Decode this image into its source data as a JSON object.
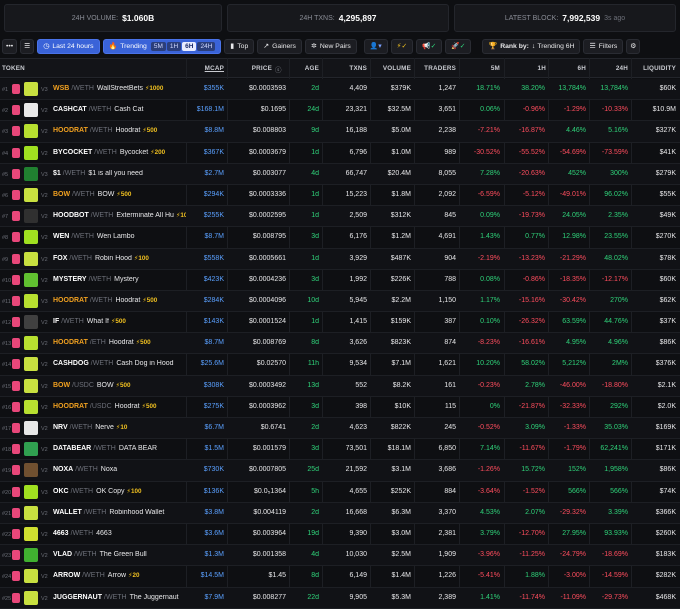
{
  "stats": {
    "volume_label": "24H VOLUME:",
    "volume_value": "$1.060B",
    "txns_label": "24H TXNS:",
    "txns_value": "4,295,897",
    "block_label": "LATEST BLOCK:",
    "block_value": "7,992,539",
    "block_ago": "3s ago"
  },
  "toolbar": {
    "period_label": "Last 24 hours",
    "trending_label": "Trending",
    "trending_options": [
      "5M",
      "1H",
      "6H",
      "24H"
    ],
    "trending_selected": "6H",
    "top_label": "Top",
    "gainers_label": "Gainers",
    "new_pairs_label": "New Pairs",
    "rank_label": "Rank by:",
    "rank_value": "Trending 6H",
    "filters_label": "Filters"
  },
  "columns": [
    "TOKEN",
    "MCAP",
    "PRICE",
    "AGE",
    "TXNS",
    "VOLUME",
    "TRADERS",
    "5M",
    "1H",
    "6H",
    "24H",
    "LIQUIDITY"
  ],
  "rows": [
    {
      "rank": "#1",
      "ver": "V3",
      "sym": "WSB",
      "orange": true,
      "pair": "/WETH",
      "name": "WallStreetBets",
      "boost": "⚡1000",
      "mcap": "$355K",
      "price": "$0.0003593",
      "age": "2d",
      "txns": "4,409",
      "volume": "$379K",
      "traders": "1,247",
      "m5": "18.71%",
      "h1": "38.20%",
      "h6": "13,784%",
      "h24": "13,784%",
      "liq": "$60K",
      "av": "#c8e040"
    },
    {
      "rank": "#2",
      "ver": "V2",
      "sym": "CASHCAT",
      "orange": false,
      "pair": "/WETH",
      "name": "Cash Cat",
      "boost": "",
      "mcap": "$168.1M",
      "price": "$0.1695",
      "age": "24d",
      "txns": "23,321",
      "volume": "$32.5M",
      "traders": "3,651",
      "m5": "0.06%",
      "h1": "-0.96%",
      "h6": "-1.29%",
      "h24": "-10.33%",
      "liq": "$10.9M",
      "av": "#e8e8e8"
    },
    {
      "rank": "#3",
      "ver": "V2",
      "sym": "HOODRAT",
      "orange": true,
      "pair": "/WETH",
      "name": "Hoodrat",
      "boost": "⚡500",
      "mcap": "$8.8M",
      "price": "$0.008803",
      "age": "9d",
      "txns": "16,188",
      "volume": "$5.0M",
      "traders": "2,238",
      "m5": "-7.21%",
      "h1": "-16.87%",
      "h6": "4.46%",
      "h24": "5.16%",
      "liq": "$327K",
      "av": "#b8e030"
    },
    {
      "rank": "#4",
      "ver": "V2",
      "sym": "BYCOCKET",
      "orange": false,
      "pair": "/WETH",
      "name": "Bycocket",
      "boost": "⚡200",
      "mcap": "$367K",
      "price": "$0.0003679",
      "age": "1d",
      "txns": "6,796",
      "volume": "$1.0M",
      "traders": "989",
      "m5": "-30.52%",
      "h1": "-55.52%",
      "h6": "-54.69%",
      "h24": "-73.59%",
      "liq": "$41K",
      "av": "#a0e020"
    },
    {
      "rank": "#5",
      "ver": "V3",
      "sym": "$1",
      "orange": false,
      "pair": "/WETH",
      "name": "$1 is all you need",
      "boost": "",
      "mcap": "$2.7M",
      "price": "$0.003077",
      "age": "4d",
      "txns": "66,747",
      "volume": "$20.4M",
      "traders": "8,055",
      "m5": "7.28%",
      "h1": "-20.63%",
      "h6": "452%",
      "h24": "300%",
      "liq": "$279K",
      "av": "#208030"
    },
    {
      "rank": "#6",
      "ver": "V2",
      "sym": "BOW",
      "orange": true,
      "pair": "/WETH",
      "name": "BOW",
      "boost": "⚡500",
      "mcap": "$294K",
      "price": "$0.0003336",
      "age": "1d",
      "txns": "15,223",
      "volume": "$1.8M",
      "traders": "2,092",
      "m5": "-6.59%",
      "h1": "-5.12%",
      "h6": "-49.01%",
      "h24": "96.02%",
      "liq": "$55K",
      "av": "#c8e040"
    },
    {
      "rank": "#7",
      "ver": "V2",
      "sym": "HOODBOT",
      "orange": false,
      "pair": "/WETH",
      "name": "Exterminate All Hu",
      "boost": "⚡10",
      "mcap": "$255K",
      "price": "$0.0002595",
      "age": "1d",
      "txns": "2,509",
      "volume": "$312K",
      "traders": "845",
      "m5": "0.09%",
      "h1": "-19.73%",
      "h6": "24.05%",
      "h24": "2.35%",
      "liq": "$49K",
      "av": "#303030"
    },
    {
      "rank": "#8",
      "ver": "V2",
      "sym": "WEN",
      "orange": false,
      "pair": "/WETH",
      "name": "Wen Lambo",
      "boost": "",
      "mcap": "$8.7M",
      "price": "$0.008795",
      "age": "3d",
      "txns": "6,176",
      "volume": "$1.2M",
      "traders": "4,691",
      "m5": "1.43%",
      "h1": "0.77%",
      "h6": "12.98%",
      "h24": "23.55%",
      "liq": "$270K",
      "av": "#a0e020"
    },
    {
      "rank": "#9",
      "ver": "V2",
      "sym": "FOX",
      "orange": false,
      "pair": "/WETH",
      "name": "Robin Hood",
      "boost": "⚡100",
      "mcap": "$558K",
      "price": "$0.0005661",
      "age": "1d",
      "txns": "3,929",
      "volume": "$487K",
      "traders": "904",
      "m5": "-2.19%",
      "h1": "-13.23%",
      "h6": "-21.29%",
      "h24": "48.02%",
      "liq": "$78K",
      "av": "#c8e040"
    },
    {
      "rank": "#10",
      "ver": "V2",
      "sym": "MYSTERY",
      "orange": false,
      "pair": "/WETH",
      "name": "Mystery",
      "boost": "",
      "mcap": "$423K",
      "price": "$0.0004236",
      "age": "3d",
      "txns": "1,992",
      "volume": "$226K",
      "traders": "788",
      "m5": "0.08%",
      "h1": "-0.86%",
      "h6": "-18.35%",
      "h24": "-12.17%",
      "liq": "$60K",
      "av": "#60c030"
    },
    {
      "rank": "#11",
      "ver": "V3",
      "sym": "HOODRAT",
      "orange": true,
      "pair": "/WETH",
      "name": "Hoodrat",
      "boost": "⚡500",
      "mcap": "$284K",
      "price": "$0.0004096",
      "age": "10d",
      "txns": "5,945",
      "volume": "$2.2M",
      "traders": "1,150",
      "m5": "1.17%",
      "h1": "-15.16%",
      "h6": "-30.42%",
      "h24": "270%",
      "liq": "$62K",
      "av": "#b8e030"
    },
    {
      "rank": "#12",
      "ver": "V2",
      "sym": "IF",
      "orange": false,
      "pair": "/WETH",
      "name": "What If",
      "boost": "⚡500",
      "mcap": "$143K",
      "price": "$0.0001524",
      "age": "1d",
      "txns": "1,415",
      "volume": "$159K",
      "traders": "387",
      "m5": "0.10%",
      "h1": "-26.32%",
      "h6": "63.59%",
      "h24": "44.76%",
      "liq": "$37K",
      "av": "#404040"
    },
    {
      "rank": "#13",
      "ver": "V2",
      "sym": "HOODRAT",
      "orange": true,
      "pair": "/ETH",
      "name": "Hoodrat",
      "boost": "⚡500",
      "mcap": "$8.7M",
      "price": "$0.008769",
      "age": "8d",
      "txns": "3,626",
      "volume": "$823K",
      "traders": "874",
      "m5": "-8.23%",
      "h1": "-16.61%",
      "h6": "4.95%",
      "h24": "4.96%",
      "liq": "$86K",
      "av": "#b8e030"
    },
    {
      "rank": "#14",
      "ver": "V2",
      "sym": "CASHDOG",
      "orange": false,
      "pair": "/WETH",
      "name": "Cash Dog in Hood",
      "boost": "",
      "mcap": "$25.6M",
      "price": "$0.02570",
      "age": "11h",
      "txns": "9,534",
      "volume": "$7.1M",
      "traders": "1,621",
      "m5": "10.20%",
      "h1": "58.02%",
      "h6": "5,212%",
      "h24": "2M%",
      "liq": "$376K",
      "av": "#c8e040"
    },
    {
      "rank": "#15",
      "ver": "V2",
      "sym": "BOW",
      "orange": true,
      "pair": "/USDC",
      "name": "BOW",
      "boost": "⚡500",
      "mcap": "$308K",
      "price": "$0.0003492",
      "age": "13d",
      "txns": "552",
      "volume": "$8.2K",
      "traders": "161",
      "m5": "-0.23%",
      "h1": "2.78%",
      "h6": "-46.00%",
      "h24": "-18.80%",
      "liq": "$2.1K",
      "av": "#c8e040"
    },
    {
      "rank": "#16",
      "ver": "V2",
      "sym": "HOODRAT",
      "orange": true,
      "pair": "/USDC",
      "name": "Hoodrat",
      "boost": "⚡500",
      "mcap": "$275K",
      "price": "$0.0003962",
      "age": "3d",
      "txns": "398",
      "volume": "$10K",
      "traders": "115",
      "m5": "0%",
      "h1": "-21.87%",
      "h6": "-32.33%",
      "h24": "292%",
      "liq": "$2.0K",
      "av": "#b8e030"
    },
    {
      "rank": "#17",
      "ver": "V2",
      "sym": "NRV",
      "orange": false,
      "pair": "/WETH",
      "name": "Nerve",
      "boost": "⚡10",
      "mcap": "$6.7M",
      "price": "$0.6741",
      "age": "2d",
      "txns": "4,623",
      "volume": "$822K",
      "traders": "245",
      "m5": "-0.52%",
      "h1": "3.09%",
      "h6": "-1.33%",
      "h24": "35.03%",
      "liq": "$169K",
      "av": "#e8e8e8"
    },
    {
      "rank": "#18",
      "ver": "V2",
      "sym": "DATABEAR",
      "orange": false,
      "pair": "/WETH",
      "name": "DATA BEAR",
      "boost": "",
      "mcap": "$1.5M",
      "price": "$0.001579",
      "age": "3d",
      "txns": "73,501",
      "volume": "$18.1M",
      "traders": "6,850",
      "m5": "7.14%",
      "h1": "-11.67%",
      "h6": "-1.79%",
      "h24": "62,241%",
      "liq": "$171K",
      "av": "#30a050"
    },
    {
      "rank": "#19",
      "ver": "V2",
      "sym": "NOXA",
      "orange": false,
      "pair": "/WETH",
      "name": "Noxa",
      "boost": "",
      "mcap": "$730K",
      "price": "$0.0007805",
      "age": "25d",
      "txns": "21,592",
      "volume": "$3.1M",
      "traders": "3,686",
      "m5": "-1.26%",
      "h1": "15.72%",
      "h6": "152%",
      "h24": "1,958%",
      "liq": "$86K",
      "av": "#705030"
    },
    {
      "rank": "#20",
      "ver": "V3",
      "sym": "OKC",
      "orange": false,
      "pair": "/WETH",
      "name": "OK Copy",
      "boost": "⚡100",
      "mcap": "$136K",
      "price": "$0.0₅1364",
      "age": "5h",
      "txns": "4,655",
      "volume": "$252K",
      "traders": "884",
      "m5": "-3.64%",
      "h1": "-1.52%",
      "h6": "566%",
      "h24": "566%",
      "liq": "$74K",
      "av": "#a0e020"
    },
    {
      "rank": "#21",
      "ver": "V2",
      "sym": "WALLET",
      "orange": false,
      "pair": "/WETH",
      "name": "Robinhood Wallet",
      "boost": "",
      "mcap": "$3.8M",
      "price": "$0.004119",
      "age": "2d",
      "txns": "16,668",
      "volume": "$6.3M",
      "traders": "3,370",
      "m5": "4.53%",
      "h1": "2.07%",
      "h6": "-29.32%",
      "h24": "3.39%",
      "liq": "$366K",
      "av": "#c8e040"
    },
    {
      "rank": "#22",
      "ver": "V2",
      "sym": "4663",
      "orange": false,
      "pair": "/WETH",
      "name": "4663",
      "boost": "",
      "mcap": "$3.6M",
      "price": "$0.003964",
      "age": "19d",
      "txns": "9,390",
      "volume": "$3.0M",
      "traders": "2,381",
      "m5": "3.79%",
      "h1": "-12.70%",
      "h6": "27.95%",
      "h24": "93.93%",
      "liq": "$260K",
      "av": "#d0e030"
    },
    {
      "rank": "#23",
      "ver": "V2",
      "sym": "VLAD",
      "orange": false,
      "pair": "/WETH",
      "name": "The Green Bull",
      "boost": "",
      "mcap": "$1.3M",
      "price": "$0.001358",
      "age": "4d",
      "txns": "10,030",
      "volume": "$2.5M",
      "traders": "1,909",
      "m5": "-3.96%",
      "h1": "-11.25%",
      "h6": "-24.79%",
      "h24": "-18.69%",
      "liq": "$183K",
      "av": "#40b030"
    },
    {
      "rank": "#24",
      "ver": "V2",
      "sym": "ARROW",
      "orange": false,
      "pair": "/WETH",
      "name": "Arrow",
      "boost": "⚡20",
      "mcap": "$14.5M",
      "price": "$1.45",
      "age": "8d",
      "txns": "6,149",
      "volume": "$1.4M",
      "traders": "1,226",
      "m5": "-5.41%",
      "h1": "1.88%",
      "h6": "-3.00%",
      "h24": "-14.59%",
      "liq": "$282K",
      "av": "#c8e040"
    },
    {
      "rank": "#25",
      "ver": "V2",
      "sym": "JUGGERNAUT",
      "orange": false,
      "pair": "/WETH",
      "name": "The Juggernaut",
      "boost": "",
      "mcap": "$7.9M",
      "price": "$0.008277",
      "age": "22d",
      "txns": "9,905",
      "volume": "$5.3M",
      "traders": "2,389",
      "m5": "1.41%",
      "h1": "-11.74%",
      "h6": "-11.09%",
      "h24": "-29.73%",
      "liq": "$468K",
      "av": "#c8e040"
    }
  ]
}
